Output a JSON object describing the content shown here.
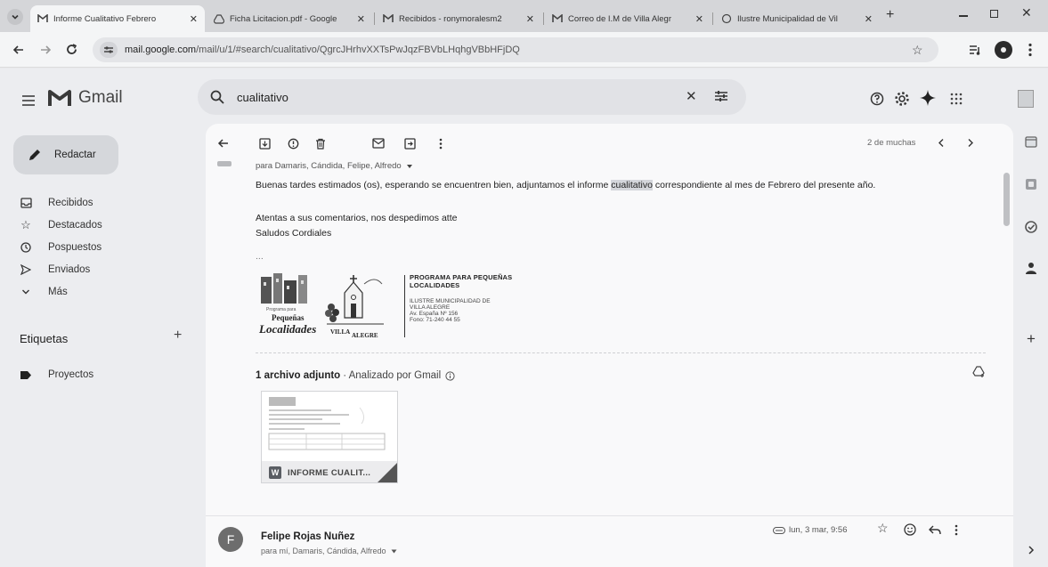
{
  "browser": {
    "tabs": [
      {
        "title": "Informe Cualitativo Febrero",
        "active": true
      },
      {
        "title": "Ficha Licitacion.pdf - Google",
        "active": false
      },
      {
        "title": "Recibidos - ronymoralesm2",
        "active": false
      },
      {
        "title": "Correo de I.M de Villa Alegr",
        "active": false
      },
      {
        "title": "Ilustre Municipalidad de Vil",
        "active": false
      }
    ],
    "new_tab_label": "+",
    "url_domain": "mail.google.com",
    "url_path": "/mail/u/1/#search/cualitativo/QgrcJHrhvXXTsPwJqzFBVbLHqhgVBbHFjDQ"
  },
  "gmail": {
    "logo_text": "Gmail",
    "compose_label": "Redactar",
    "nav": [
      {
        "label": "Recibidos",
        "icon": "inbox-icon"
      },
      {
        "label": "Destacados",
        "icon": "star-icon"
      },
      {
        "label": "Pospuestos",
        "icon": "clock-icon"
      },
      {
        "label": "Enviados",
        "icon": "send-icon"
      },
      {
        "label": "Más",
        "icon": "chevron-down-icon"
      }
    ],
    "labels_heading": "Etiquetas",
    "labels_add": "+",
    "labels": [
      {
        "label": "Proyectos"
      }
    ],
    "search": {
      "value": "cualitativo"
    },
    "pagination": "2 de muchas",
    "email": {
      "recipients": "para Damaris, Cándida, Felipe, Alfredo",
      "line1_before": "Buenas tardes estimados (os), esperando se encuentren bien, adjuntamos el informe ",
      "line1_highlight": "cualitativo",
      "line1_after": " correspondiente al mes de Febrero del presente año.",
      "line2": "Atentas a sus comentarios, nos despedimos atte",
      "line3": "Saludos Cordiales",
      "ellipsis": "...",
      "signature": {
        "program_line1": "PROGRAMA PARA PEQUEÑAS",
        "program_line2": "LOCALIDADES",
        "muni_line1": "ILUSTRE MUNICIPALIDAD DE",
        "muni_line2": "VILLA ALEGRE",
        "address": "Av. España Nº 156",
        "phone": "Fono: 71-240 44 55",
        "logo_small": "Programa para",
        "logo_pequenas": "Pequeñas",
        "logo_localidades": "Localidades",
        "logo_villa": "VILLA",
        "logo_alegre": "ALEGRE"
      },
      "attachments_count": "1 archivo adjunto",
      "attachments_scan": "· Analizado por Gmail",
      "attachment_name": "INFORME CUALIT..."
    },
    "next_message": {
      "avatar_letter": "F",
      "sender": "Felipe Rojas Nuñez",
      "recipients": "para mí, Damaris, Cándida, Alfredo",
      "date": "lun, 3 mar, 9:56"
    }
  },
  "colors": {
    "avatar": "#6d6d6d",
    "panel": "#f9f9fa",
    "background": "#ecedf0"
  }
}
